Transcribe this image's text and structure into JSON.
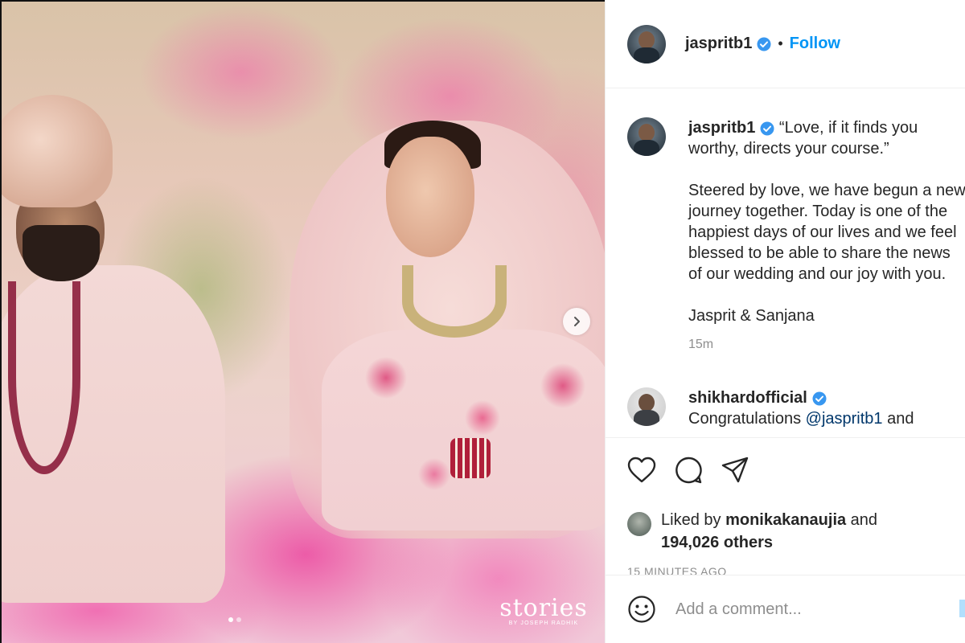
{
  "post": {
    "watermark_brand": "stories",
    "watermark_by": "BY JOSEPH RADHIK",
    "carousel": {
      "current": 1,
      "total": 2
    }
  },
  "header": {
    "username": "jaspritb1",
    "separator": "•",
    "follow_label": "Follow"
  },
  "caption": {
    "username": "jaspritb1",
    "text": "“Love, if it finds you worthy, directs your course.”\n\nSteered by love, we have begun a new journey together. Today is one of the happiest days of our lives and we feel blessed to be able to share the news of our wedding and our joy with you.\n\nJasprit & Sanjana",
    "time": "15m"
  },
  "comments": [
    {
      "username": "shikhardofficial",
      "text_prefix": "Congratulations ",
      "mention": "@jaspritb1",
      "text_suffix": " and"
    }
  ],
  "actions": {
    "icons": [
      "heart-icon",
      "comment-icon",
      "share-icon"
    ]
  },
  "likes": {
    "prefix": "Liked by ",
    "user": "monikakanaujia",
    "middle": " and",
    "others": "194,026 others"
  },
  "timestamp": "15 MINUTES AGO",
  "add_comment": {
    "placeholder": "Add a comment..."
  },
  "colors": {
    "accent": "#0095f6",
    "verified": "#3897f0",
    "text": "#262626",
    "muted": "#8e8e8e"
  }
}
